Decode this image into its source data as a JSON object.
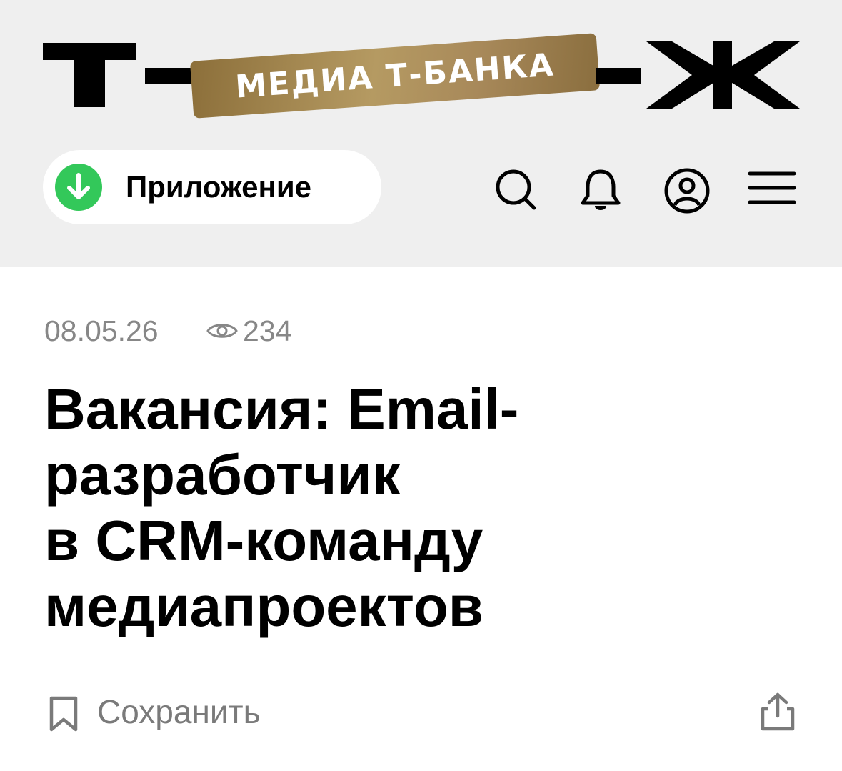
{
  "header": {
    "logo_badge_text": "МЕДИА Т-БАНКА",
    "app_button_label": "Приложение",
    "colors": {
      "background": "#efefef",
      "app_icon_green": "#33c85a",
      "badge_gold": "#a8895a"
    },
    "icons": [
      "download-arrow-icon",
      "search-icon",
      "bell-icon",
      "profile-icon",
      "menu-icon"
    ]
  },
  "article": {
    "date": "08.05.26",
    "views": "234",
    "title_lines": [
      "Вакансия: Email-",
      "разработчик",
      "в CRM-команду",
      "медиапроектов"
    ],
    "save_label": "Сохранить",
    "icons": [
      "eye-icon",
      "bookmark-icon",
      "share-icon"
    ]
  }
}
